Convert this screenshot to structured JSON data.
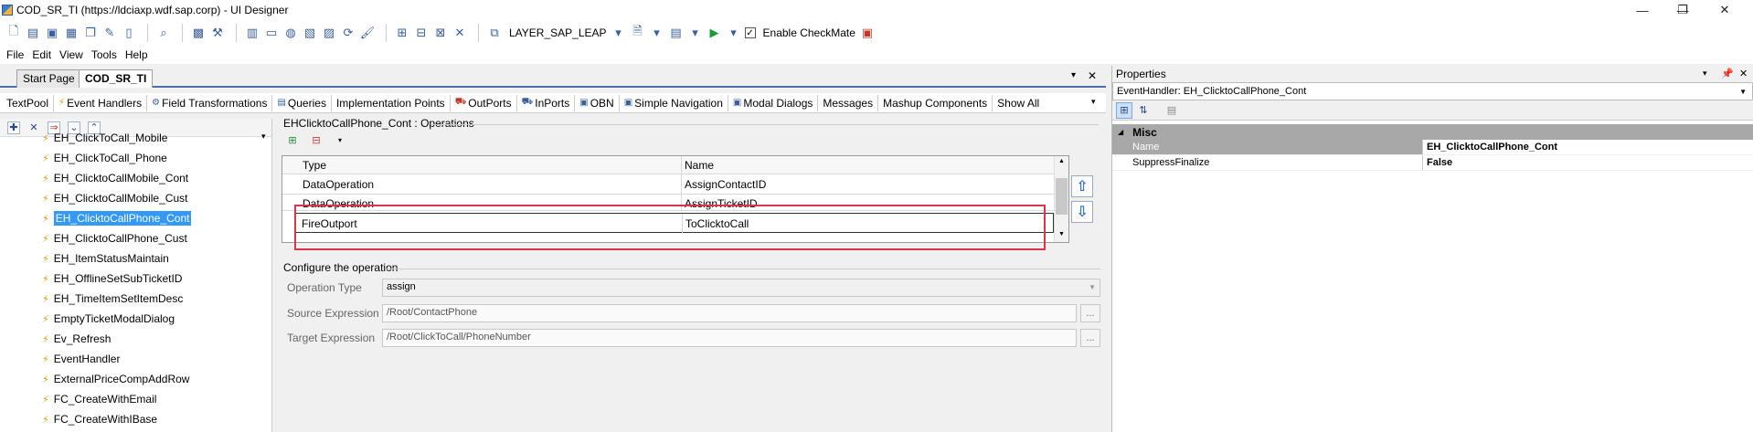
{
  "window": {
    "title": "COD_SR_TI (https://ldciaxp.wdf.sap.corp) - UI Designer",
    "minimize": "—",
    "maximize": "❐",
    "close": "✕"
  },
  "toolbar": {
    "layer": "LAYER_SAP_LEAP",
    "checkmate_label": "Enable CheckMate",
    "checkmate_checked": "✓"
  },
  "menu": [
    "File",
    "Edit",
    "View",
    "Tools",
    "Help"
  ],
  "doc_tabs": {
    "start_page": "Start Page",
    "current": "COD_SR_TI",
    "close_x": "✕"
  },
  "editor_tabs": [
    "TextPool",
    "Event Handlers",
    "Field Transformations",
    "Queries",
    "Implementation Points",
    "OutPorts",
    "InPorts",
    "OBN",
    "Simple Navigation",
    "Modal Dialogs",
    "Messages",
    "Mashup Components",
    "Show All"
  ],
  "tree": {
    "items": [
      "EH_ClickToCall_Mobile",
      "EH_ClickToCall_Phone",
      "EH_ClicktoCallMobile_Cont",
      "EH_ClicktoCallMobile_Cust",
      "EH_ClicktoCallPhone_Cont",
      "EH_ClicktoCallPhone_Cust",
      "EH_ItemStatusMaintain",
      "EH_OfflineSetSubTicketID",
      "EH_TimeItemSetItemDesc",
      "EmptyTicketModalDialog",
      "Ev_Refresh",
      "EventHandler",
      "ExternalPriceCompAddRow",
      "FC_CreateWithEmail",
      "FC_CreateWithIBase"
    ],
    "selected_index": 4
  },
  "operations": {
    "header": "EHClicktoCallPhone_Cont : Operations",
    "columns": [
      "Type",
      "Name"
    ],
    "rows": [
      {
        "type": "DataOperation",
        "name": "AssignContactID"
      },
      {
        "type": "DataOperation",
        "name": "AssignTicketID"
      },
      {
        "type": "FireOutport",
        "name": "ToClicktoCall"
      }
    ]
  },
  "configure": {
    "title": "Configure the operation",
    "operation_type_label": "Operation Type",
    "operation_type_value": "assign",
    "source_label": "Source Expression",
    "source_value": "/Root/ContactPhone",
    "target_label": "Target Expression",
    "target_value": "/Root/ClickToCall/PhoneNumber",
    "ellipsis": "..."
  },
  "properties": {
    "title": "Properties",
    "object": "EventHandler: EH_ClicktoCallPhone_Cont",
    "category": "Misc",
    "rows": [
      {
        "name": "Name",
        "value": "EH_ClicktoCallPhone_Cont"
      },
      {
        "name": "SuppressFinalize",
        "value": "False"
      }
    ]
  },
  "colors": {
    "selection": "#3399ff",
    "highlight_box": "#d9364b",
    "accent": "#4a6ea9"
  }
}
